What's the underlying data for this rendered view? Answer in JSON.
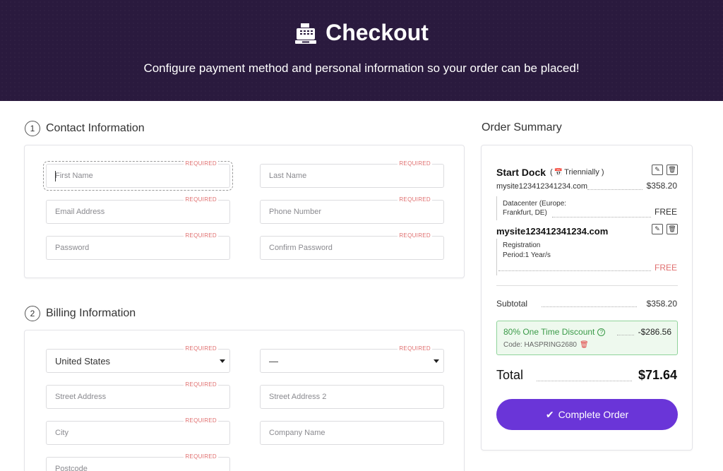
{
  "header": {
    "title": "Checkout",
    "icon": "cash-register-icon",
    "subtitle": "Configure payment method and personal information so your order can be placed!"
  },
  "contact": {
    "step": "1",
    "title": "Contact Information",
    "required_label": "REQUIRED",
    "first_name_ph": "First Name",
    "last_name_ph": "Last Name",
    "email_ph": "Email Address",
    "phone_ph": "Phone Number",
    "password_ph": "Password",
    "confirm_password_ph": "Confirm Password"
  },
  "billing": {
    "step": "2",
    "title": "Billing Information",
    "country_value": "United States",
    "state_value": "—",
    "street_ph": "Street Address",
    "street2_ph": "Street Address 2",
    "city_ph": "City",
    "company_ph": "Company Name",
    "postcode_ph": "Postcode"
  },
  "summary": {
    "title": "Order Summary",
    "product1": {
      "name": "Start Dock",
      "cycle": "Triennially )",
      "cycle_open": "(",
      "domain": "mysite123412341234.com",
      "price": "$358.20",
      "option_line1": "Datacenter (Europe:",
      "option_line2": "Frankfurt, DE)",
      "option_price": "FREE"
    },
    "product2": {
      "name": "mysite123412341234.com",
      "line1": "Registration",
      "line2": "Period:1 Year/s",
      "price": "FREE"
    },
    "subtotal_label": "Subtotal",
    "subtotal_value": "$358.20",
    "discount": {
      "label": "80% One Time Discount",
      "value": "-$286.56",
      "code": "Code: HASPRING2680"
    },
    "total_label": "Total",
    "total_value": "$71.64",
    "complete_label": "Complete Order"
  },
  "colors": {
    "header_bg": "#2a1a3e",
    "accent": "#6a35d8",
    "required": "#e07070",
    "free": "#e07070",
    "discount_green": "#3a9a48"
  }
}
